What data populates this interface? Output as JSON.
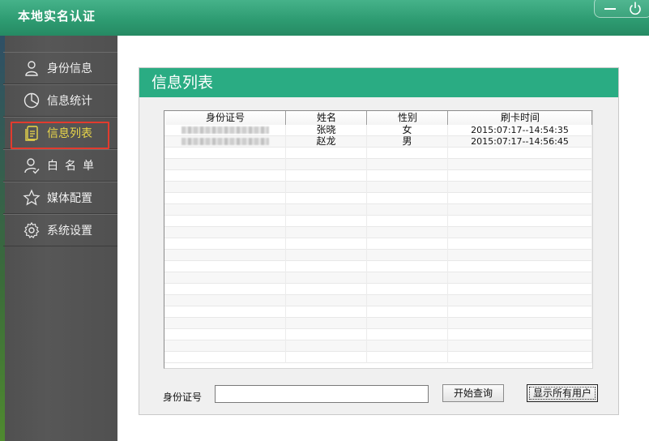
{
  "app": {
    "title": "本地实名认证"
  },
  "window_controls": {
    "minimize_icon": "minimize-icon",
    "power_icon": "power-icon"
  },
  "colors": {
    "accent": "#2aac83",
    "active_text": "#e9d64a",
    "highlight_border": "#e23b2e"
  },
  "sidebar": {
    "items": [
      {
        "label": "身份信息",
        "icon": "user-icon"
      },
      {
        "label": "信息统计",
        "icon": "pie-chart-icon"
      },
      {
        "label": "信息列表",
        "icon": "document-list-icon",
        "active": true
      },
      {
        "label": "白名单",
        "icon": "user-check-icon"
      },
      {
        "label": "媒体配置",
        "icon": "star-icon"
      },
      {
        "label": "系统设置",
        "icon": "gear-icon"
      }
    ]
  },
  "main": {
    "panel_title": "信息列表",
    "table": {
      "columns": [
        "身份证号",
        "姓名",
        "性别",
        "刷卡时间"
      ],
      "rows": [
        {
          "name": "张晓",
          "gender": "女",
          "time": "2015:07:17--14:54:35"
        },
        {
          "name": "赵龙",
          "gender": "男",
          "time": "2015:07:17--14:56:45"
        }
      ]
    },
    "search": {
      "label": "身份证号",
      "value": "",
      "query_button": "开始查询",
      "show_all_button": "显示所有用户"
    }
  }
}
